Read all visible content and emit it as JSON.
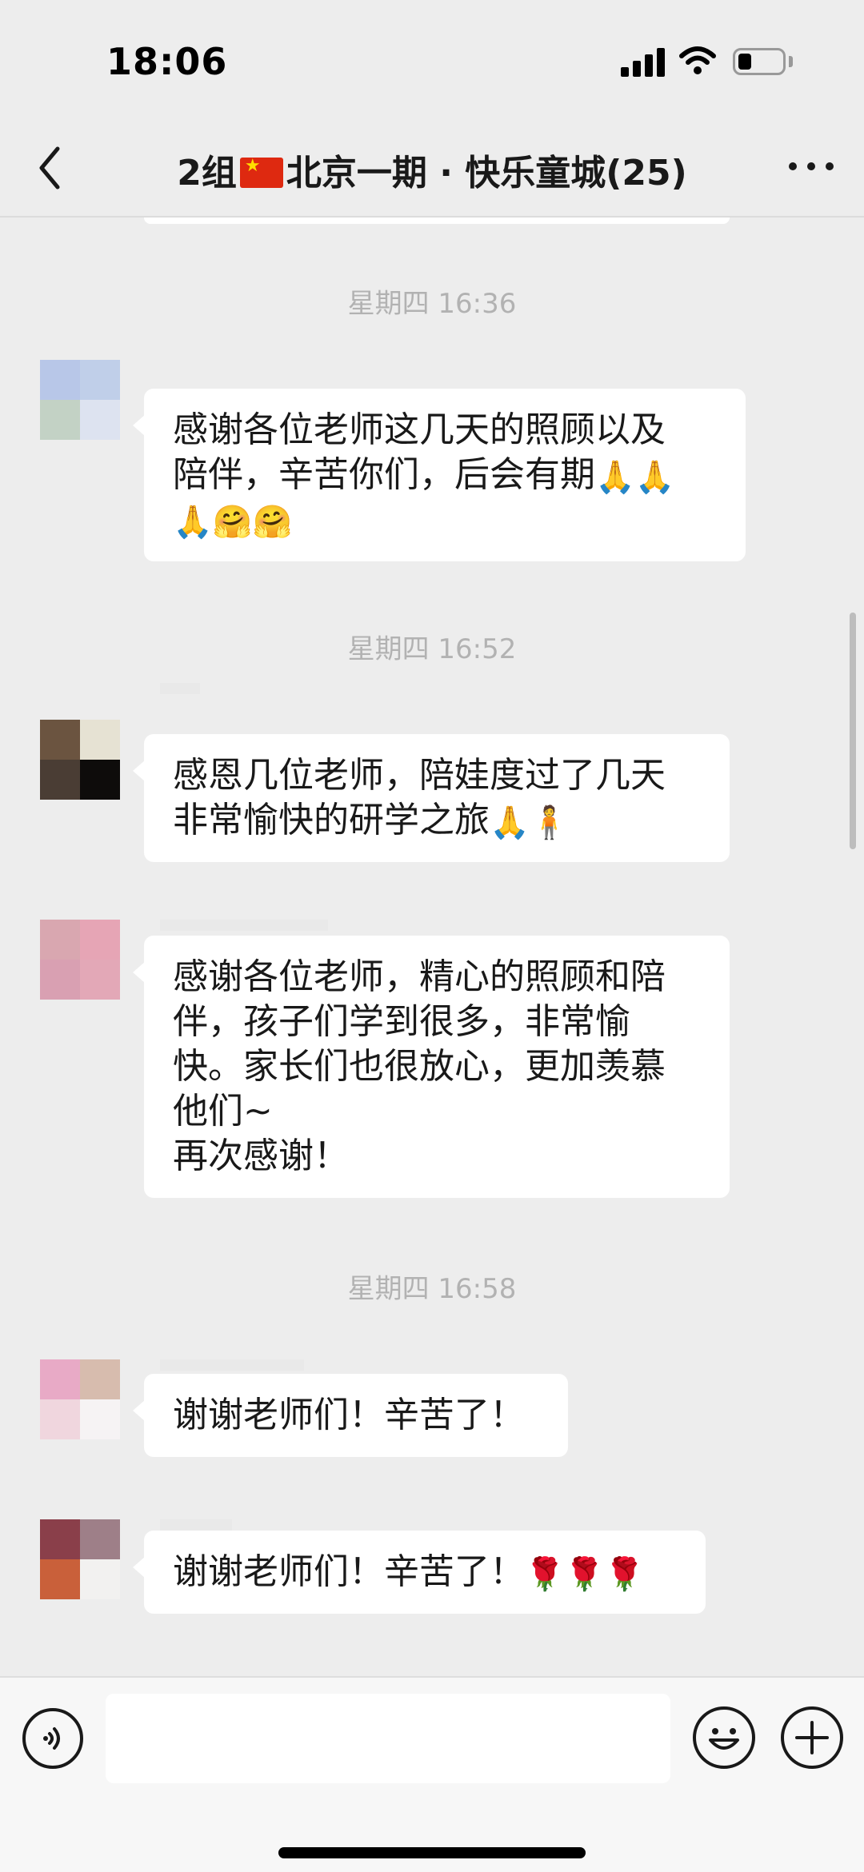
{
  "status_bar": {
    "time": "18:06"
  },
  "header": {
    "title_prefix": "2组",
    "title_flag": "🇨🇳",
    "title_suffix": "北京一期 · 快乐童城(25)"
  },
  "input": {
    "placeholder": "",
    "value": ""
  },
  "timestamps": [
    "星期四 16:36",
    "星期四 16:52",
    "星期四 16:58"
  ],
  "messages": [
    {
      "text": "感谢各位老师这几天的照顾以及\n陪伴，辛苦你们，后会有期",
      "emojis_line1": "🙏🙏",
      "emojis_line2": "🙏🤗🤗",
      "avatar_colors": [
        "#b8c7e8",
        "#c0cfe9",
        "#c3d2c5",
        "#dde3f0"
      ]
    },
    {
      "text": "感恩几位老师，陪娃度过了几天\n非常愉快的研学之旅",
      "emojis": "🙏🧍",
      "avatar_colors": [
        "#6b5440",
        "#e6e2d3",
        "#4a3d34",
        "#0e0c0b"
      ]
    },
    {
      "text": "感谢各位老师，精心的照顾和陪\n伴，孩子们学到很多，非常愉\n快。家长们也很放心，更加羡慕\n他们~\n再次感谢！",
      "avatar_colors": [
        "#d9a7b0",
        "#e6a5b5",
        "#d9a0b2",
        "#e3a8b7"
      ]
    },
    {
      "text": "谢谢老师们！辛苦了！",
      "avatar_colors": [
        "#e8aac6",
        "#d7bcae",
        "#f0d6de",
        "#f6f3f4"
      ]
    },
    {
      "text": "谢谢老师们！辛苦了！",
      "emojis": "🌹🌹🌹",
      "avatar_colors": [
        "#8a3f4a",
        "#9e7f88",
        "#c9603a",
        "#f2f1f0"
      ]
    }
  ]
}
